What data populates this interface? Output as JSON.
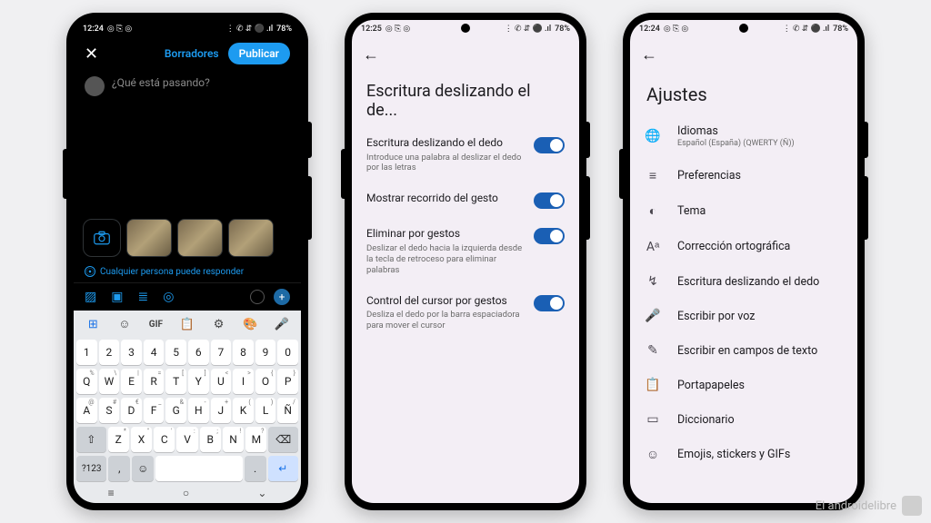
{
  "status": {
    "time_a": "12:24",
    "time_b": "12:25",
    "battery": "78%",
    "icons_left": "◎ ⎘ ◎",
    "icons_right": "⋮ ✆ ⇵ ⚫ .ıl"
  },
  "phone1": {
    "drafts": "Borradores",
    "publish": "Publicar",
    "prompt": "¿Qué está pasando?",
    "reply_scope": "Cualquier persona puede responder",
    "kb_gif": "GIF",
    "kb_numbers": [
      "1",
      "2",
      "3",
      "4",
      "5",
      "6",
      "7",
      "8",
      "9",
      "0"
    ],
    "kb_row1": [
      "Q",
      "W",
      "E",
      "R",
      "T",
      "Y",
      "U",
      "I",
      "O",
      "P"
    ],
    "kb_row2": [
      "A",
      "S",
      "D",
      "F",
      "G",
      "H",
      "J",
      "K",
      "L",
      "Ñ"
    ],
    "kb_row3": [
      "Z",
      "X",
      "C",
      "V",
      "B",
      "N",
      "M"
    ],
    "kb_sym": "?123",
    "kb_comma": ",",
    "kb_dot": "."
  },
  "phone2": {
    "title": "Escritura deslizando el de...",
    "items": [
      {
        "label": "Escritura deslizando el dedo",
        "sub": "Introduce una palabra al deslizar el dedo por las letras"
      },
      {
        "label": "Mostrar recorrido del gesto",
        "sub": ""
      },
      {
        "label": "Eliminar por gestos",
        "sub": "Deslizar el dedo hacia la izquierda desde la tecla de retroceso para eliminar palabras"
      },
      {
        "label": "Control del cursor por gestos",
        "sub": "Desliza el dedo por la barra espaciadora para mover el cursor"
      }
    ]
  },
  "phone3": {
    "title": "Ajustes",
    "items": [
      {
        "icon": "🌐",
        "label": "Idiomas",
        "sub": "Español (España) (QWERTY (Ñ))"
      },
      {
        "icon": "≡",
        "label": "Preferencias",
        "sub": ""
      },
      {
        "icon": "◐",
        "label": "Tema",
        "sub": ""
      },
      {
        "icon": "Aᵃ",
        "label": "Corrección ortográfica",
        "sub": ""
      },
      {
        "icon": "↯",
        "label": "Escritura deslizando el dedo",
        "sub": ""
      },
      {
        "icon": "🎤",
        "label": "Escribir por voz",
        "sub": ""
      },
      {
        "icon": "✎",
        "label": "Escribir en campos de texto",
        "sub": ""
      },
      {
        "icon": "📋",
        "label": "Portapapeles",
        "sub": ""
      },
      {
        "icon": "▭",
        "label": "Diccionario",
        "sub": ""
      },
      {
        "icon": "☺",
        "label": "Emojis, stickers y GIFs",
        "sub": ""
      }
    ]
  },
  "watermark": "El androidelibre"
}
